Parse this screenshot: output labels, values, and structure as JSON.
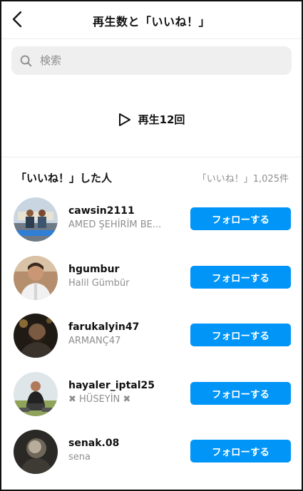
{
  "header": {
    "title": "再生数と「いいね！」",
    "back_icon": "chevron-left-icon"
  },
  "search": {
    "placeholder": "検索",
    "value": ""
  },
  "plays": {
    "label": "再生12回",
    "icon": "play-icon"
  },
  "likes": {
    "title": "「いいね！」した人",
    "count_label": "「いいね！」1,025件"
  },
  "follow_label": "フォローする",
  "users": [
    {
      "username": "cawsin2111",
      "name": "AMED ŞEHİRİM BE..."
    },
    {
      "username": "hgumbur",
      "name": "Halil Gümbür"
    },
    {
      "username": "farukalyin47",
      "name": "ARMANÇ47"
    },
    {
      "username": "hayaler_iptal25",
      "name": "✖ HÜSEYİN ✖"
    },
    {
      "username": "senak.08",
      "name": "sena"
    }
  ],
  "colors": {
    "follow_button": "#0095f6",
    "secondary_text": "#8e8e8e",
    "search_bg": "#efefef"
  }
}
